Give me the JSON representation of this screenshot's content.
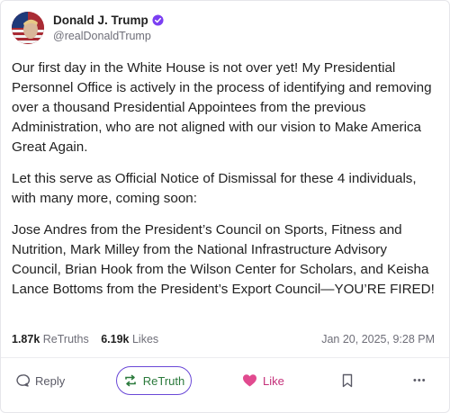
{
  "account": {
    "display_name": "Donald J. Trump",
    "handle": "@realDonaldTrump",
    "verified": true
  },
  "post": {
    "paragraphs": [
      "Our first day in the White House is not over yet! My Presidential Personnel Office is actively in the process of identifying and removing over a thousand Presidential Appointees from the previous Administration, who are not aligned with our vision to Make America Great Again.",
      "Let this serve as Official Notice of Dismissal for these 4 individuals, with many more, coming soon:",
      "Jose Andres from the President’s Council on Sports, Fitness and Nutrition, Mark Milley from the National Infrastructure Advisory Council, Brian Hook from the Wilson Center for Scholars, and Keisha Lance Bottoms from the President’s Export Council—YOU’RE FIRED!"
    ]
  },
  "stats": {
    "retruths_count": "1.87k",
    "retruths_label": "ReTruths",
    "likes_count": "6.19k",
    "likes_label": "Likes",
    "timestamp": "Jan 20, 2025, 9:28 PM"
  },
  "actions": {
    "reply_label": "Reply",
    "retruth_label": "ReTruth",
    "like_label": "Like",
    "more_label": "•••"
  },
  "colors": {
    "retruth_green": "#2b7a3c",
    "retruth_outline": "#6a48d7",
    "like_pink": "#c4307a",
    "verified_purple": "#7b3ff2"
  }
}
